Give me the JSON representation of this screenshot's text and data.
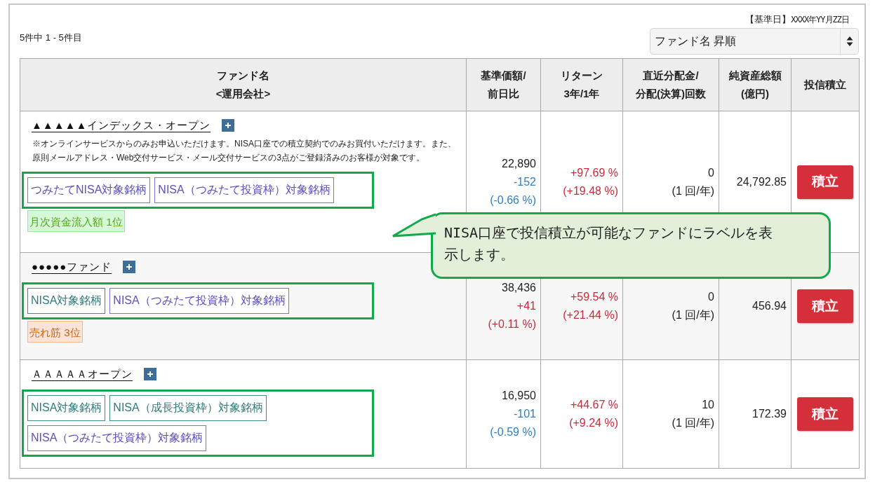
{
  "base_date": {
    "label": "【基準日】",
    "value": "XXXX年YY月ZZ日"
  },
  "result_count": "5件中 1 - 5件目",
  "sort_select": {
    "value": "ファンド名 昇順"
  },
  "table": {
    "columns": [
      [
        "ファンド名",
        "<運用会社>"
      ],
      [
        "基準価額/",
        "前日比"
      ],
      [
        "リターン",
        "3年/1年"
      ],
      [
        "直近分配金/",
        "分配(決算)回数"
      ],
      [
        "純資産総額",
        "(億円)"
      ],
      [
        "投信積立"
      ]
    ],
    "rows": [
      {
        "name": "▲▲▲▲▲インデックス・オープン",
        "note": "※オンラインサービスからのみお申込いただけます。NISA口座での積立契約でのみお買付いただけます。また、原則メールアドレス・Web交付サービス・メール交付サービスの3点がご登録済みのお客様が対象です。",
        "tags": [
          {
            "kind": "tsumitate",
            "label": "つみたてNISA対象銘柄"
          },
          {
            "kind": "tsumitate",
            "label": "NISA（つみたて投資枠）対象銘柄"
          }
        ],
        "rank": {
          "kind": "inflow",
          "label": "月次資金流入額 1位"
        },
        "price": "22,890",
        "change": "-152",
        "change_pct": "(-0.66 %)",
        "kind": "down",
        "return_3y": "+97.69 %",
        "return_1y": "(+19.48 %)",
        "distribution": "0",
        "frequency": "(1 回/年)",
        "net_assets": "24,792.85",
        "button": "積立"
      },
      {
        "name": "●●●●●ファンド",
        "tags": [
          {
            "kind": "nisa",
            "label": "NISA対象銘柄"
          },
          {
            "kind": "tsumitate",
            "label": "NISA（つみたて投資枠）対象銘柄"
          }
        ],
        "rank": {
          "kind": "sales",
          "label": "売れ筋 3位"
        },
        "price": "38,436",
        "change": "+41",
        "change_pct": "(+0.11 %)",
        "kind": "up",
        "return_3y": "+59.54 %",
        "return_1y": "(+21.44 %)",
        "distribution": "0",
        "frequency": "(1 回/年)",
        "net_assets": "456.94",
        "button": "積立"
      },
      {
        "name": "ＡＡＡＡＡオープン",
        "tags": [
          {
            "kind": "nisa",
            "label": "NISA対象銘柄"
          },
          {
            "kind": "nisa",
            "label": "NISA（成長投資枠）対象銘柄"
          },
          {
            "kind": "tsumitate",
            "label": "NISA（つみたて投資枠）対象銘柄"
          }
        ],
        "price": "16,950",
        "change": "-101",
        "change_pct": "(-0.59 %)",
        "kind": "down",
        "return_3y": "+44.67 %",
        "return_1y": "(+9.24 %)",
        "distribution": "10",
        "frequency": "(1 回/年)",
        "net_assets": "172.39",
        "button": "積立"
      }
    ]
  },
  "callout": "NISA口座で投信積立が可能なファンドにラベルを表示します。"
}
